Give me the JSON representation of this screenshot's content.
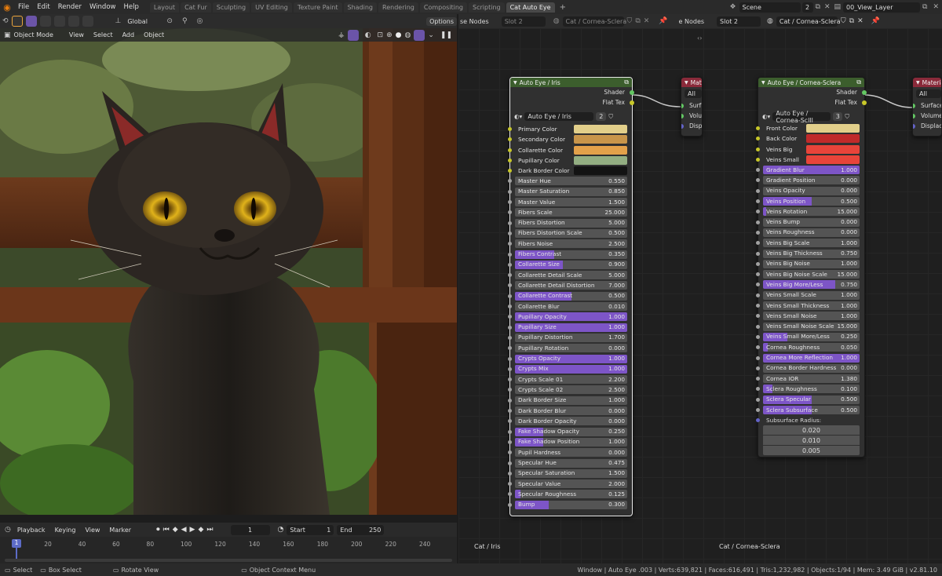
{
  "topbar": {
    "menus": [
      "File",
      "Edit",
      "Render",
      "Window",
      "Help"
    ],
    "workspaces": [
      "Layout",
      "Cat Fur",
      "Sculpting",
      "UV Editing",
      "Texture Paint",
      "Shading",
      "Rendering",
      "Compositing",
      "Scripting",
      "Cat Auto Eye"
    ],
    "active_workspace": "Cat Auto Eye",
    "scene": "Scene",
    "scene_users": "2",
    "view_layer": "00_View_Layer"
  },
  "viewport": {
    "mode": "Object Mode",
    "menus": [
      "View",
      "Select",
      "Add",
      "Object"
    ],
    "orientation": "Global",
    "options": "Options"
  },
  "node_editor": {
    "left": {
      "editor_label": "se Nodes",
      "slot": "Slot 2",
      "material": "Cat / Cornea-Sclera",
      "frame_label": "Cat / Iris"
    },
    "right": {
      "editor_label": "e Nodes",
      "slot": "Slot 2",
      "material": "Cat / Cornea-Sclera",
      "frame_label": "Cat / Cornea-Sclera"
    }
  },
  "nodes": {
    "iris": {
      "title": "Auto Eye / Iris",
      "outputs": [
        "Shader",
        "Flat Tex"
      ],
      "group_name": "Auto Eye / Iris",
      "users": "2",
      "colors": [
        {
          "label": "Primary Color",
          "color": "#e2cf8a"
        },
        {
          "label": "Secondary Color",
          "color": "#c8954a"
        },
        {
          "label": "Collarette Color",
          "color": "#e3a14a"
        },
        {
          "label": "Pupillary Color",
          "color": "#93ae82"
        },
        {
          "label": "Dark Border Color",
          "color": "#131313"
        }
      ],
      "params": [
        {
          "label": "Master Hue",
          "value": "0.550",
          "fill": 0
        },
        {
          "label": "Master Saturation",
          "value": "0.850",
          "fill": 0
        },
        {
          "label": "Master Value",
          "value": "1.500",
          "fill": 0
        },
        {
          "label": "Fibers Scale",
          "value": "25.000",
          "fill": 0
        },
        {
          "label": "Fibers Distortion",
          "value": "5.000",
          "fill": 0
        },
        {
          "label": "Fibers Distortion Scale",
          "value": "0.500",
          "fill": 0
        },
        {
          "label": "Fibers Noise",
          "value": "2.500",
          "fill": 0
        },
        {
          "label": "Fibers Contrast",
          "value": "0.350",
          "fill": 0.35
        },
        {
          "label": "Collarette Size",
          "value": "0.900",
          "fill": 0.43
        },
        {
          "label": "Collarette Detail Scale",
          "value": "5.000",
          "fill": 0
        },
        {
          "label": "Collarette Detail Distortion",
          "value": "7.000",
          "fill": 0
        },
        {
          "label": "Collarette Contrast",
          "value": "0.500",
          "fill": 0.5
        },
        {
          "label": "Collarette Blur",
          "value": "0.010",
          "fill": 0
        },
        {
          "label": "Pupillary Opacity",
          "value": "1.000",
          "fill": 1
        },
        {
          "label": "Pupillary Size",
          "value": "1.000",
          "fill": 1
        },
        {
          "label": "Pupillary Distortion",
          "value": "1.700",
          "fill": 0
        },
        {
          "label": "Pupillary Rotation",
          "value": "0.000",
          "fill": 0
        },
        {
          "label": "Crypts Opacity",
          "value": "1.000",
          "fill": 1
        },
        {
          "label": "Crypts Mix",
          "value": "1.000",
          "fill": 1
        },
        {
          "label": "Crypts Scale 01",
          "value": "2.200",
          "fill": 0
        },
        {
          "label": "Crypts Scale 02",
          "value": "2.500",
          "fill": 0
        },
        {
          "label": "Dark Border Size",
          "value": "1.000",
          "fill": 0
        },
        {
          "label": "Dark Border Blur",
          "value": "0.000",
          "fill": 0
        },
        {
          "label": "Dark Border Opacity",
          "value": "0.000",
          "fill": 0
        },
        {
          "label": "Fake Shadow Opacity",
          "value": "0.250",
          "fill": 0.25
        },
        {
          "label": "Fake Shadow Position",
          "value": "1.000",
          "fill": 0.25
        },
        {
          "label": "Pupil Hardness",
          "value": "0.000",
          "fill": 0
        },
        {
          "label": "Specular Hue",
          "value": "0.475",
          "fill": 0
        },
        {
          "label": "Specular Saturation",
          "value": "1.500",
          "fill": 0
        },
        {
          "label": "Specular Value",
          "value": "2.000",
          "fill": 0
        },
        {
          "label": "Specular Roughness",
          "value": "0.125",
          "fill": 0.05
        },
        {
          "label": "Bump",
          "value": "0.300",
          "fill": 0.3
        }
      ]
    },
    "cornea": {
      "title": "Auto Eye / Cornea-Sclera",
      "outputs": [
        "Shader",
        "Flat Tex"
      ],
      "group_name": "Auto Eye / Cornea-Sclll",
      "users": "3",
      "colors": [
        {
          "label": "Front Color",
          "color": "#e2cf8a"
        },
        {
          "label": "Back Color",
          "color": "#c02a2a"
        },
        {
          "label": "Veins Big",
          "color": "#e8443a"
        },
        {
          "label": "Veins Small",
          "color": "#e8443a"
        }
      ],
      "params": [
        {
          "label": "Gradient Blur",
          "value": "1.000",
          "fill": 1
        },
        {
          "label": "Gradient Position",
          "value": "0.000",
          "fill": 0
        },
        {
          "label": "Veins Opacity",
          "value": "0.000",
          "fill": 0
        },
        {
          "label": "Veins Position",
          "value": "0.500",
          "fill": 0.5
        },
        {
          "label": "Veins Rotation",
          "value": "15.000",
          "fill": 0.03
        },
        {
          "label": "Veins Bump",
          "value": "0.000",
          "fill": 0
        },
        {
          "label": "Veins Roughness",
          "value": "0.000",
          "fill": 0
        },
        {
          "label": "Veins Big Scale",
          "value": "1.000",
          "fill": 0
        },
        {
          "label": "Veins Big Thickness",
          "value": "0.750",
          "fill": 0
        },
        {
          "label": "Veins Big Noise",
          "value": "1.000",
          "fill": 0
        },
        {
          "label": "Veins Big Noise Scale",
          "value": "15.000",
          "fill": 0
        },
        {
          "label": "Veins Big More/Less",
          "value": "0.750",
          "fill": 0.75
        },
        {
          "label": "Veins Small  Scale",
          "value": "1.000",
          "fill": 0
        },
        {
          "label": "Veins Small Thickness",
          "value": "1.000",
          "fill": 0
        },
        {
          "label": "Veins Small Noise",
          "value": "1.000",
          "fill": 0
        },
        {
          "label": "Veins Small Noise Scale",
          "value": "15.000",
          "fill": 0
        },
        {
          "label": "Veins Small More/Less",
          "value": "0.250",
          "fill": 0.25
        },
        {
          "label": "Cornea Roughness",
          "value": "0.050",
          "fill": 0.05
        },
        {
          "label": "Cornea More Reflection",
          "value": "1.000",
          "fill": 1
        },
        {
          "label": "Cornea Border Hardness",
          "value": "0.000",
          "fill": 0
        },
        {
          "label": "Cornea IOR",
          "value": "1.380",
          "fill": 0
        },
        {
          "label": "Sclera Roughness",
          "value": "0.100",
          "fill": 0.1
        },
        {
          "label": "Sclera Specular",
          "value": "0.500",
          "fill": 0.5
        },
        {
          "label": "Sclera Subsurface",
          "value": "0.500",
          "fill": 0.5
        }
      ],
      "subsurface_label": "Subsurface Radius:",
      "subsurface": [
        "0.020",
        "0.010",
        "0.005"
      ]
    },
    "mat1": {
      "title": "Mat",
      "target": "All",
      "inputs": [
        "Surf",
        "Volu",
        "Disp"
      ]
    },
    "mat2": {
      "title": "Materia",
      "target": "All",
      "inputs": [
        "Surface",
        "Volume",
        "Displace"
      ]
    }
  },
  "timeline": {
    "menus": [
      "Playback",
      "Keying",
      "View",
      "Marker"
    ],
    "current": "1",
    "start_label": "Start",
    "start": "1",
    "end_label": "End",
    "end": "250",
    "ticks": [
      "1",
      "20",
      "40",
      "60",
      "80",
      "100",
      "120",
      "140",
      "160",
      "180",
      "200",
      "220",
      "240"
    ]
  },
  "status": {
    "hints": [
      "Select",
      "Box Select",
      "Rotate View",
      "Object Context Menu"
    ],
    "stats": "Window | Auto Eye .003 | Verts:639,821 | Faces:616,491 | Tris:1,232,982 | Objects:1/94 | Mem: 3.49 GiB | v2.81.10"
  }
}
